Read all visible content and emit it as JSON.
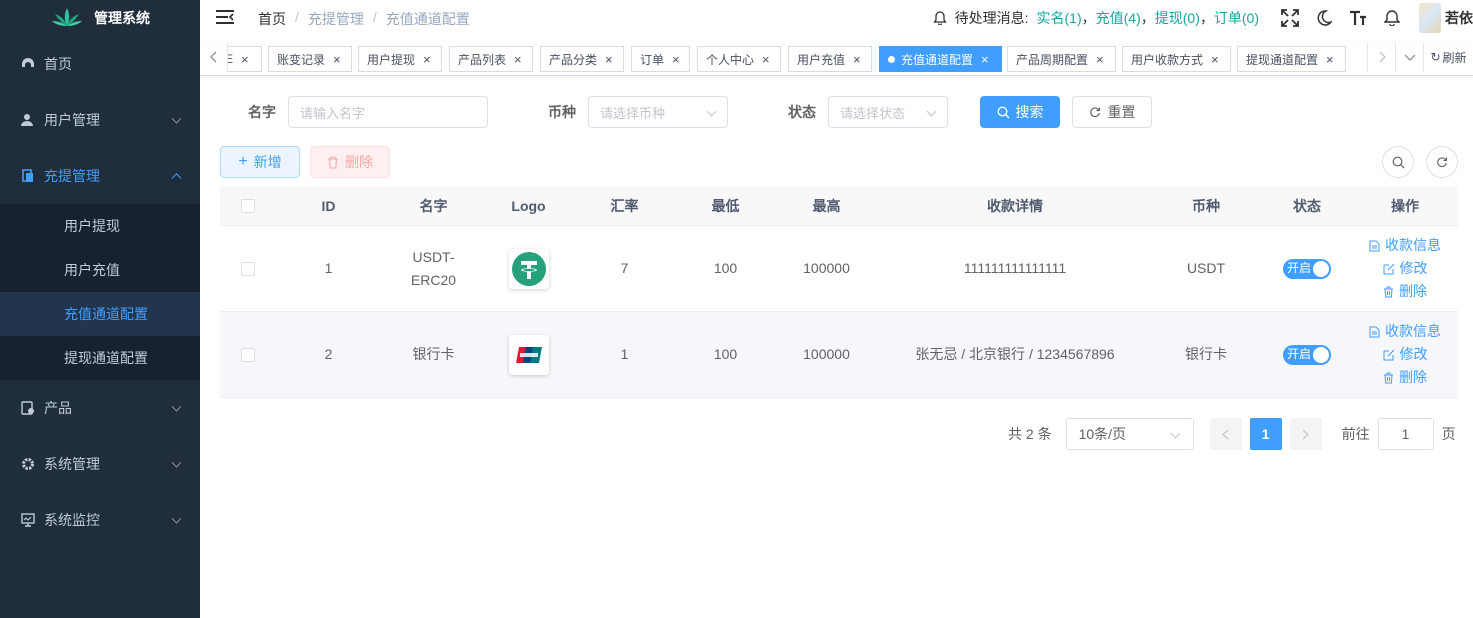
{
  "app": {
    "title": "管理系统"
  },
  "sidebar": {
    "items": [
      {
        "label": "首页",
        "icon": "dashboard-icon"
      },
      {
        "label": "用户管理",
        "icon": "user-icon"
      },
      {
        "label": "充提管理",
        "icon": "document-icon"
      },
      {
        "label": "产品",
        "icon": "product-icon"
      },
      {
        "label": "系统管理",
        "icon": "gear-icon"
      },
      {
        "label": "系统监控",
        "icon": "monitor-icon"
      }
    ],
    "submenu": [
      "用户提现",
      "用户充值",
      "充值通道配置",
      "提现通道配置"
    ]
  },
  "navbar": {
    "breadcrumb": [
      "首页",
      "/",
      "充提管理",
      "/",
      "充值通道配置"
    ],
    "notice_label": "待处理消息:",
    "notices": [
      "实名(1)",
      "充值(4)",
      "提现(0)",
      "订单(0)"
    ],
    "notice_sep": "，",
    "username": "若依"
  },
  "tags": {
    "items": [
      "E",
      "账变记录",
      "用户提现",
      "产品列表",
      "产品分类",
      "订单",
      "个人中心",
      "用户充值",
      "充值通道配置",
      "产品周期配置",
      "用户收款方式",
      "提现通道配置"
    ],
    "active": "充值通道配置",
    "refresh": "刷新"
  },
  "search": {
    "name_label": "名字",
    "name_placeholder": "请输入名字",
    "currency_label": "币种",
    "currency_placeholder": "请选择币种",
    "status_label": "状态",
    "status_placeholder": "请选择状态",
    "search_btn": "搜索",
    "reset_btn": "重置"
  },
  "toolbar": {
    "add": "新增",
    "delete": "删除"
  },
  "table": {
    "columns": [
      "ID",
      "名字",
      "Logo",
      "汇率",
      "最低",
      "最高",
      "收款详情",
      "币种",
      "状态",
      "操作"
    ],
    "rows": [
      {
        "id": "1",
        "name_line1": "USDT-",
        "name_line2": "ERC20",
        "logo": "tether-logo",
        "rate": "7",
        "min": "100",
        "max": "100000",
        "detail": "111111111111111",
        "currency": "USDT",
        "status": "开启"
      },
      {
        "id": "2",
        "name_line1": "银行卡",
        "name_line2": "",
        "logo": "unionpay-logo",
        "rate": "1",
        "min": "100",
        "max": "100000",
        "detail": "张无忌 / 北京银行 / 1234567896",
        "currency": "银行卡",
        "status": "开启"
      }
    ],
    "ops": [
      "收款信息",
      "修改",
      "删除"
    ]
  },
  "pager": {
    "total": "共 2 条",
    "page_size": "10条/页",
    "current": "1",
    "goto_label": "前往",
    "goto_value": "1",
    "page_unit": "页"
  },
  "colors": {
    "primary": "#409eff",
    "sidebar_bg": "#1f2d3d",
    "notice_link": "#13a89e"
  }
}
